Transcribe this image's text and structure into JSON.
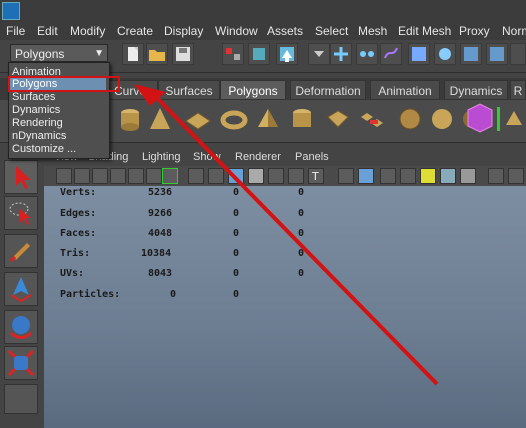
{
  "menubar": {
    "items": [
      "File",
      "Edit",
      "Modify",
      "Create",
      "Display",
      "Window",
      "Assets",
      "Select",
      "Mesh",
      "Edit Mesh",
      "Proxy",
      "Normal"
    ]
  },
  "statusline": {
    "mode_selector": "Polygons"
  },
  "mode_dropdown": {
    "items": [
      "Animation",
      "Polygons",
      "Surfaces",
      "Dynamics",
      "Rendering",
      "nDynamics",
      "Customize ..."
    ],
    "selected": "Polygons"
  },
  "shelf_tabs": {
    "tabs": [
      "Curves",
      "Surfaces",
      "Polygons",
      "Deformation",
      "Animation",
      "Dynamics",
      "R"
    ],
    "active": "Polygons"
  },
  "panel_menu": {
    "items": [
      "View",
      "Shading",
      "Lighting",
      "Show",
      "Renderer",
      "Panels"
    ]
  },
  "heads_up": {
    "rows": [
      {
        "label": "Verts:",
        "v1": "5236",
        "v2": "0",
        "v3": "0"
      },
      {
        "label": "Edges:",
        "v1": "9266",
        "v2": "0",
        "v3": "0"
      },
      {
        "label": "Faces:",
        "v1": "4048",
        "v2": "0",
        "v3": "0"
      },
      {
        "label": "Tris:",
        "v1": "10384",
        "v2": "0",
        "v3": "0"
      },
      {
        "label": "UVs:",
        "v1": "8043",
        "v2": "0",
        "v3": "0"
      },
      {
        "label": "Particles:",
        "v1": "0",
        "v2": "0",
        "v3": ""
      }
    ]
  },
  "colors": {
    "annotation_red": "#d31313",
    "selection_blue": "#6d8fb2",
    "viewport_top": "#7d8ea2",
    "viewport_bottom": "#5a6a7f"
  }
}
